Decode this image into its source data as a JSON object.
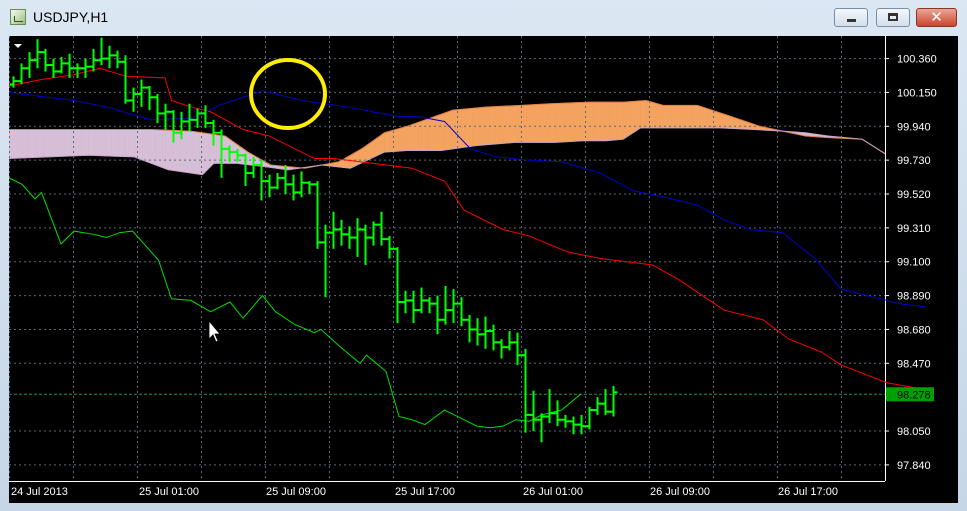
{
  "window": {
    "title": "USDJPY,H1",
    "icon": "chart-window-icon",
    "controls": {
      "minimize": "minimize-icon",
      "maximize": "maximize-icon",
      "close": "close-icon",
      "close_glyph": "✕"
    }
  },
  "chart_data": {
    "type": "candlestick",
    "symbol": "USDJPY",
    "timeframe": "H1",
    "grid": true,
    "y_ticks": [
      "100.360",
      "100.150",
      "99.940",
      "99.730",
      "99.520",
      "99.310",
      "99.100",
      "98.890",
      "98.680",
      "98.470",
      "98.050",
      "97.840"
    ],
    "x_ticks": [
      "24 Jul 2013",
      "25 Jul 01:00",
      "25 Jul 09:00",
      "25 Jul 17:00",
      "26 Jul 01:00",
      "26 Jul 09:00",
      "26 Jul 17:00"
    ],
    "ylim": [
      97.74,
      100.5
    ],
    "current_price": "98.278",
    "colors": {
      "background": "#000000",
      "grid": "#5a6a78",
      "bars": "#00ff00",
      "tenkan": "#ff0000",
      "kijun": "#0000cc",
      "chikou": "#00dd00",
      "kumo_bullish": "#f4a460",
      "kumo_bearish": "#d8bfd8",
      "price_line": "#2e8b57",
      "highlight_circle": "#ffee00",
      "axis_text": "#ffffff"
    },
    "bars": [
      [
        100.2,
        100.25,
        100.18,
        100.22
      ],
      [
        100.22,
        100.33,
        100.2,
        100.3
      ],
      [
        100.3,
        100.4,
        100.24,
        100.35
      ],
      [
        100.35,
        100.48,
        100.3,
        100.4
      ],
      [
        100.4,
        100.42,
        100.28,
        100.32
      ],
      [
        100.32,
        100.36,
        100.24,
        100.28
      ],
      [
        100.28,
        100.37,
        100.27,
        100.33
      ],
      [
        100.33,
        100.39,
        100.24,
        100.3
      ],
      [
        100.3,
        100.33,
        100.24,
        100.3
      ],
      [
        100.3,
        100.36,
        100.24,
        100.31
      ],
      [
        100.31,
        100.42,
        100.28,
        100.35
      ],
      [
        100.35,
        100.49,
        100.32,
        100.36
      ],
      [
        100.36,
        100.44,
        100.3,
        100.38
      ],
      [
        100.38,
        100.41,
        100.3,
        100.34
      ],
      [
        100.34,
        100.38,
        100.08,
        100.1
      ],
      [
        100.1,
        100.18,
        100.03,
        100.14
      ],
      [
        100.14,
        100.23,
        100.06,
        100.18
      ],
      [
        100.18,
        100.19,
        100.04,
        100.12
      ],
      [
        100.12,
        100.14,
        99.96,
        100.02
      ],
      [
        100.02,
        100.08,
        99.92,
        100.03
      ],
      [
        100.03,
        100.04,
        99.84,
        99.9
      ],
      [
        99.9,
        100.03,
        99.86,
        99.97
      ],
      [
        99.97,
        100.08,
        99.91,
        99.98
      ],
      [
        99.98,
        100.05,
        99.93,
        100.02
      ],
      [
        100.02,
        100.07,
        99.93,
        99.96
      ],
      [
        99.96,
        99.98,
        99.82,
        99.9
      ],
      [
        99.9,
        99.92,
        99.62,
        99.8
      ],
      [
        99.8,
        99.82,
        99.72,
        99.78
      ],
      [
        99.78,
        99.8,
        99.72,
        99.76
      ],
      [
        99.76,
        99.77,
        99.57,
        99.65
      ],
      [
        99.65,
        99.75,
        99.62,
        99.7
      ],
      [
        99.7,
        99.73,
        99.48,
        99.6
      ],
      [
        99.6,
        99.64,
        99.5,
        99.56
      ],
      [
        99.56,
        99.65,
        99.55,
        99.62
      ],
      [
        99.62,
        99.7,
        99.52,
        99.58
      ],
      [
        99.58,
        99.64,
        99.48,
        99.53
      ],
      [
        99.53,
        99.66,
        99.5,
        99.59
      ],
      [
        99.59,
        99.6,
        99.52,
        99.58
      ],
      [
        99.58,
        99.6,
        99.18,
        99.22
      ],
      [
        99.22,
        99.33,
        98.88,
        99.28
      ],
      [
        99.28,
        99.41,
        99.18,
        99.3
      ],
      [
        99.3,
        99.36,
        99.2,
        99.27
      ],
      [
        99.27,
        99.32,
        99.18,
        99.25
      ],
      [
        99.25,
        99.37,
        99.13,
        99.3
      ],
      [
        99.3,
        99.33,
        99.08,
        99.25
      ],
      [
        99.25,
        99.35,
        99.2,
        99.33
      ],
      [
        99.33,
        99.41,
        99.2,
        99.24
      ],
      [
        99.24,
        99.26,
        99.12,
        99.18
      ],
      [
        99.18,
        99.19,
        98.72,
        98.85
      ],
      [
        98.85,
        98.92,
        98.78,
        98.86
      ],
      [
        98.86,
        98.92,
        98.72,
        98.8
      ],
      [
        98.8,
        98.94,
        98.78,
        98.86
      ],
      [
        98.86,
        98.88,
        98.78,
        98.84
      ],
      [
        98.84,
        98.89,
        98.65,
        98.74
      ],
      [
        98.74,
        98.95,
        98.71,
        98.8
      ],
      [
        98.8,
        98.93,
        98.72,
        98.84
      ],
      [
        98.84,
        98.88,
        98.7,
        98.74
      ],
      [
        98.74,
        98.77,
        98.6,
        98.68
      ],
      [
        98.68,
        98.75,
        98.58,
        98.65
      ],
      [
        98.65,
        98.76,
        98.56,
        98.67
      ],
      [
        98.67,
        98.71,
        98.55,
        98.6
      ],
      [
        98.6,
        98.62,
        98.5,
        98.57
      ],
      [
        98.57,
        98.67,
        98.55,
        98.6
      ],
      [
        98.6,
        98.66,
        98.46,
        98.52
      ],
      [
        98.52,
        98.56,
        98.04,
        98.15
      ],
      [
        98.15,
        98.3,
        98.05,
        98.12
      ],
      [
        98.12,
        98.16,
        97.98,
        98.14
      ],
      [
        98.14,
        98.31,
        98.1,
        98.16
      ],
      [
        98.16,
        98.24,
        98.08,
        98.12
      ],
      [
        98.12,
        98.15,
        98.07,
        98.11
      ],
      [
        98.11,
        98.14,
        98.03,
        98.09
      ],
      [
        98.09,
        98.15,
        98.03,
        98.08
      ],
      [
        98.08,
        98.2,
        98.06,
        98.18
      ],
      [
        98.18,
        98.26,
        98.15,
        98.22
      ],
      [
        98.22,
        98.31,
        98.15,
        98.17
      ],
      [
        98.17,
        98.33,
        98.14,
        98.29
      ]
    ],
    "tenkan": [
      [
        0,
        100.19
      ],
      [
        5,
        100.23
      ],
      [
        10,
        100.26
      ],
      [
        14,
        100.3
      ],
      [
        18,
        100.25
      ],
      [
        24,
        100.24
      ],
      [
        25,
        100.1
      ],
      [
        28,
        100.06
      ],
      [
        31,
        100.03
      ],
      [
        36,
        99.92
      ],
      [
        40,
        99.88
      ],
      [
        47,
        99.74
      ],
      [
        50,
        99.74
      ],
      [
        58,
        99.7
      ],
      [
        62,
        99.68
      ],
      [
        67,
        99.6
      ],
      [
        70,
        99.42
      ],
      [
        76,
        99.3
      ],
      [
        80,
        99.26
      ],
      [
        86,
        99.16
      ],
      [
        91,
        99.12
      ],
      [
        99,
        99.08
      ],
      [
        103,
        98.99
      ],
      [
        110,
        98.8
      ],
      [
        116,
        98.74
      ],
      [
        120,
        98.62
      ],
      [
        125,
        98.54
      ],
      [
        128,
        98.46
      ],
      [
        135,
        98.35
      ],
      [
        142,
        98.3
      ]
    ],
    "kijun": [
      [
        0,
        100.15
      ],
      [
        10,
        100.1
      ],
      [
        15,
        100.06
      ],
      [
        22,
        99.98
      ],
      [
        28,
        99.99
      ],
      [
        33,
        100.08
      ],
      [
        39,
        100.16
      ],
      [
        45,
        100.1
      ],
      [
        52,
        100.06
      ],
      [
        60,
        100.0
      ],
      [
        63,
        100.0
      ],
      [
        67,
        99.97
      ],
      [
        71,
        99.8
      ],
      [
        75,
        99.75
      ],
      [
        80,
        99.73
      ],
      [
        85,
        99.72
      ],
      [
        91,
        99.65
      ],
      [
        96,
        99.54
      ],
      [
        101,
        99.5
      ],
      [
        106,
        99.45
      ],
      [
        110,
        99.36
      ],
      [
        114,
        99.3
      ],
      [
        119,
        99.28
      ],
      [
        124,
        99.12
      ],
      [
        128,
        98.93
      ],
      [
        133,
        98.88
      ],
      [
        137,
        98.84
      ],
      [
        141,
        98.82
      ]
    ],
    "chikou": [
      [
        0,
        99.62
      ],
      [
        2,
        99.58
      ],
      [
        4,
        99.49
      ],
      [
        5,
        99.53
      ],
      [
        8,
        99.21
      ],
      [
        10,
        99.29
      ],
      [
        13,
        99.27
      ],
      [
        15,
        99.25
      ],
      [
        17,
        99.28
      ],
      [
        19,
        99.29
      ],
      [
        23,
        99.11
      ],
      [
        25,
        98.87
      ],
      [
        28,
        98.86
      ],
      [
        31,
        98.79
      ],
      [
        34,
        98.85
      ],
      [
        36,
        98.75
      ],
      [
        39,
        98.89
      ],
      [
        41,
        98.79
      ],
      [
        44,
        98.71
      ],
      [
        47,
        98.66
      ],
      [
        48,
        98.68
      ],
      [
        51,
        98.57
      ],
      [
        54,
        98.47
      ],
      [
        55,
        98.52
      ],
      [
        58,
        98.42
      ],
      [
        60,
        98.14
      ],
      [
        62,
        98.12
      ],
      [
        64,
        98.09
      ],
      [
        67,
        98.18
      ],
      [
        70,
        98.12
      ],
      [
        72,
        98.08
      ],
      [
        74,
        98.07
      ],
      [
        76,
        98.08
      ],
      [
        78,
        98.12
      ],
      [
        80,
        98.11
      ],
      [
        82,
        98.15
      ],
      [
        85,
        98.18
      ],
      [
        88,
        98.28
      ]
    ],
    "kumo_a": [
      [
        0,
        99.92
      ],
      [
        25,
        99.92
      ],
      [
        32,
        99.91
      ],
      [
        38,
        99.88
      ],
      [
        42,
        99.78
      ],
      [
        46,
        99.7
      ],
      [
        49,
        99.69
      ],
      [
        52,
        99.68
      ],
      [
        55,
        99.7
      ],
      [
        58,
        99.72
      ],
      [
        62,
        99.8
      ],
      [
        66,
        99.9
      ],
      [
        70,
        99.94
      ],
      [
        74,
        99.99
      ],
      [
        78,
        100.04
      ],
      [
        84,
        100.06
      ],
      [
        90,
        100.07
      ],
      [
        95,
        100.08
      ],
      [
        102,
        100.09
      ],
      [
        108,
        100.09
      ],
      [
        112,
        100.1
      ],
      [
        115,
        100.07
      ],
      [
        121,
        100.07
      ],
      [
        127,
        100.0
      ],
      [
        132,
        99.94
      ],
      [
        136,
        99.91
      ],
      [
        140,
        99.88
      ],
      [
        144,
        99.87
      ],
      [
        150,
        99.86
      ],
      [
        154,
        99.77
      ]
    ],
    "kumo_b": [
      [
        0,
        99.74
      ],
      [
        14,
        99.76
      ],
      [
        22,
        99.75
      ],
      [
        28,
        99.67
      ],
      [
        34,
        99.64
      ],
      [
        36,
        99.71
      ],
      [
        40,
        99.71
      ],
      [
        45,
        99.69
      ],
      [
        49,
        99.67
      ],
      [
        55,
        99.7
      ],
      [
        60,
        99.68
      ],
      [
        66,
        99.78
      ],
      [
        70,
        99.79
      ],
      [
        76,
        99.79
      ],
      [
        82,
        99.82
      ],
      [
        89,
        99.84
      ],
      [
        96,
        99.84
      ],
      [
        101,
        99.85
      ],
      [
        105,
        99.85
      ],
      [
        108,
        99.86
      ],
      [
        111,
        99.93
      ],
      [
        118,
        99.93
      ],
      [
        125,
        99.93
      ],
      [
        131,
        99.92
      ],
      [
        136,
        99.91
      ],
      [
        140,
        99.9
      ],
      [
        144,
        99.88
      ],
      [
        150,
        99.86
      ],
      [
        154,
        99.77
      ]
    ]
  }
}
